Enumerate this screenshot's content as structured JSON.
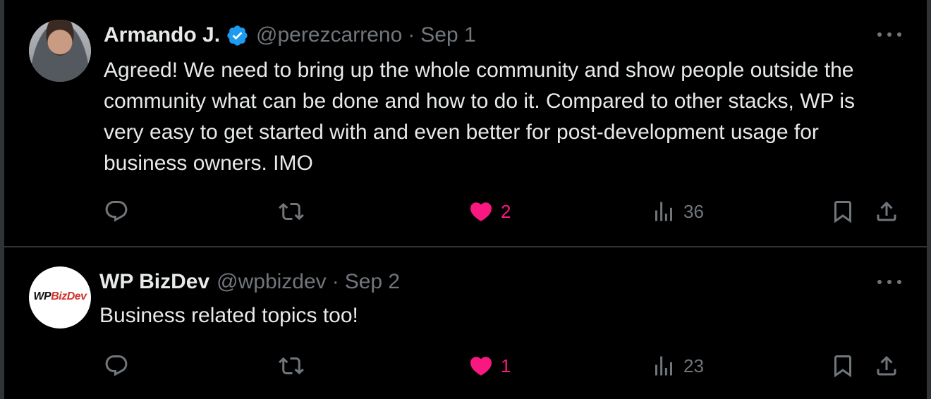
{
  "tweets": [
    {
      "author": {
        "name": "Armando J.",
        "verified": true,
        "handle": "@perezcarreno",
        "avatar_icon": "profile-photo"
      },
      "separator": "·",
      "date": "Sep 1",
      "text": "Agreed! We need to bring up the whole community and show people outside the community what can be done and how to do it. Compared to other stacks, WP is very easy to get started with and even better for post-development usage for business owners. IMO",
      "stats": {
        "replies": "",
        "retweets": "",
        "likes": "2",
        "liked": true,
        "views": "36"
      }
    },
    {
      "author": {
        "name": "WP BizDev",
        "verified": false,
        "handle": "@wpbizdev",
        "avatar_icon": "wpbizdev-logo",
        "logo_text_wp": "WP",
        "logo_text_biz": "BizDev"
      },
      "separator": "·",
      "date": "Sep 2",
      "text": "Business related topics too!",
      "stats": {
        "replies": "",
        "retweets": "",
        "likes": "1",
        "liked": true,
        "views": "23"
      }
    }
  ],
  "colors": {
    "background": "#000000",
    "text": "#e7e9ea",
    "muted": "#71767b",
    "like": "#f91880",
    "verified": "#1d9bf0",
    "divider": "#2f3336"
  },
  "icons": {
    "reply": "reply-icon",
    "retweet": "retweet-icon",
    "like": "heart-icon",
    "views": "views-icon",
    "bookmark": "bookmark-icon",
    "share": "share-icon",
    "more": "more-icon",
    "verified": "verified-badge-icon"
  }
}
